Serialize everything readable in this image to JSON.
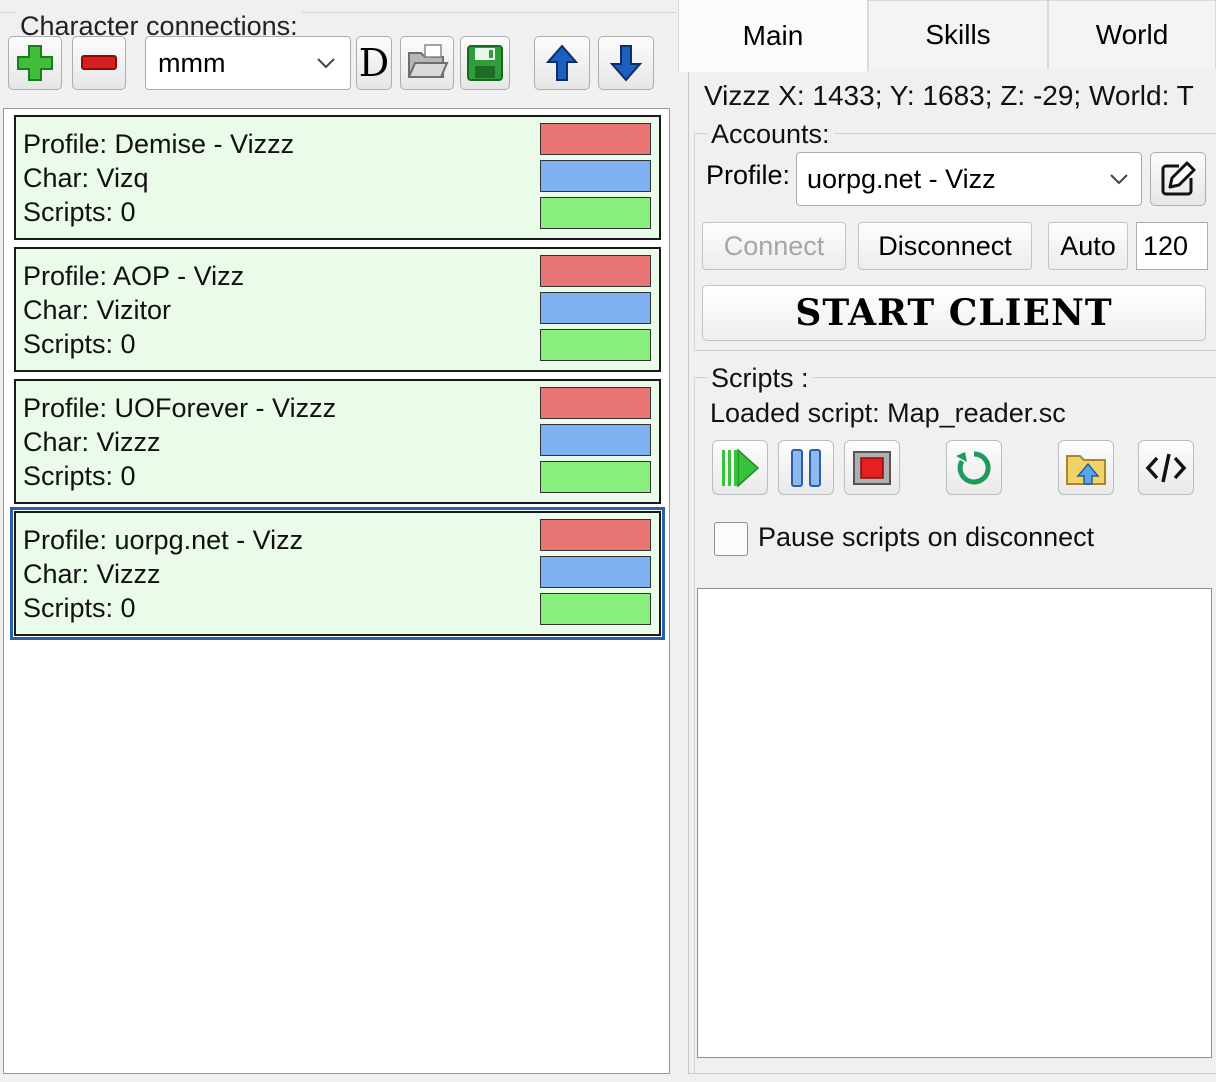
{
  "left": {
    "title": "Character connections:",
    "toolbar": {
      "profile_value": "mmm",
      "d_label": "D",
      "icons": [
        "plus-icon",
        "minus-icon",
        "chevron-down-icon",
        "folder-open-icon",
        "save-icon",
        "arrow-up-icon",
        "arrow-down-icon"
      ]
    },
    "characters": [
      {
        "profile": "Profile: Demise - Vizzz",
        "char": "Char: Vizq",
        "scripts": "Scripts: 0",
        "selected": false
      },
      {
        "profile": "Profile: AOP - Vizz",
        "char": "Char: Vizitor",
        "scripts": "Scripts: 0",
        "selected": false
      },
      {
        "profile": "Profile: UOForever - Vizzz",
        "char": "Char: Vizzz",
        "scripts": "Scripts: 0",
        "selected": false
      },
      {
        "profile": "Profile: uorpg.net - Vizz",
        "char": "Char: Vizzz",
        "scripts": "Scripts: 0",
        "selected": true
      }
    ],
    "bar_colors": {
      "red": "#e97474",
      "blue": "#7eb0f2",
      "green": "#89ef7c"
    }
  },
  "right": {
    "tabs": [
      {
        "label": "Main",
        "active": true
      },
      {
        "label": "Skills",
        "active": false
      },
      {
        "label": "World",
        "active": false
      }
    ],
    "position_text": "Vizzz X: 1433; Y: 1683; Z: -29; World: T",
    "accounts": {
      "title": "Accounts:",
      "profile_label": "Profile:",
      "profile_value": "uorpg.net - Vizz",
      "connect_label": "Connect",
      "disconnect_label": "Disconnect",
      "auto_label": "Auto",
      "auto_value": "120",
      "start_label": "START CLIENT"
    },
    "scripts": {
      "title": "Scripts :",
      "loaded_label": "Loaded script:  Map_reader.sc",
      "buttons": [
        "play-icon",
        "pause-icon",
        "stop-icon",
        "reload-icon",
        "open-script-icon",
        "code-icon"
      ],
      "pause_on_disconnect_label": "Pause scripts on disconnect",
      "pause_on_disconnect_checked": false
    }
  }
}
